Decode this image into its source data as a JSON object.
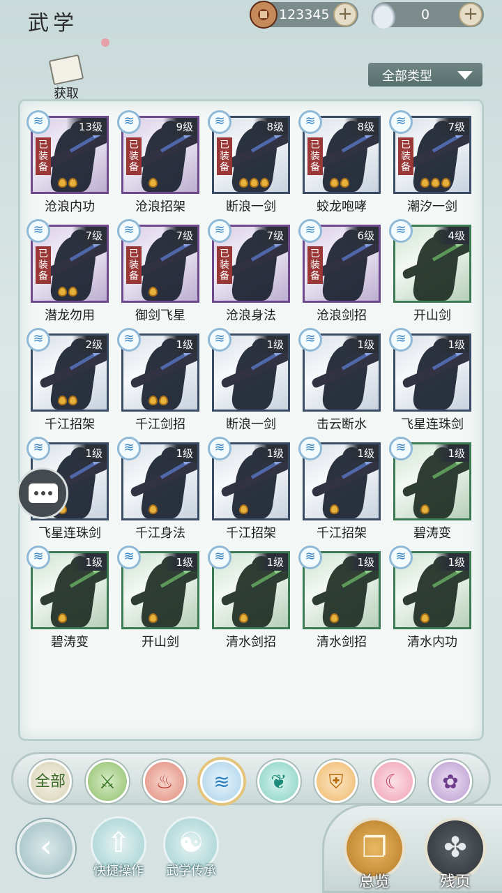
{
  "header": {
    "title": "武学",
    "copper_coins": "123345",
    "silver_ingots": "0",
    "plus_symbol": "+"
  },
  "toolbar": {
    "acquire_label": "获取",
    "filter_label": "全部类型"
  },
  "skills": [
    {
      "name": "沧浪内功",
      "level": "13级",
      "equipped": true,
      "tier": "purple",
      "pips": 2
    },
    {
      "name": "沧浪招架",
      "level": "9级",
      "equipped": true,
      "tier": "purple",
      "pips": 1
    },
    {
      "name": "断浪一剑",
      "level": "8级",
      "equipped": true,
      "tier": "blue",
      "pips": 3
    },
    {
      "name": "蛟龙咆哮",
      "level": "8级",
      "equipped": true,
      "tier": "blue",
      "pips": 2
    },
    {
      "name": "潮汐一剑",
      "level": "7级",
      "equipped": true,
      "tier": "blue",
      "pips": 3
    },
    {
      "name": "潜龙勿用",
      "level": "7级",
      "equipped": true,
      "tier": "purple",
      "pips": 2
    },
    {
      "name": "御剑飞星",
      "level": "7级",
      "equipped": true,
      "tier": "purple",
      "pips": 1
    },
    {
      "name": "沧浪身法",
      "level": "7级",
      "equipped": true,
      "tier": "purple",
      "pips": 0
    },
    {
      "name": "沧浪剑招",
      "level": "6级",
      "equipped": true,
      "tier": "purple",
      "pips": 0
    },
    {
      "name": "开山剑",
      "level": "4级",
      "equipped": false,
      "tier": "green",
      "pips": 0
    },
    {
      "name": "千江招架",
      "level": "2级",
      "equipped": false,
      "tier": "blue",
      "pips": 2
    },
    {
      "name": "千江剑招",
      "level": "1级",
      "equipped": false,
      "tier": "blue",
      "pips": 2
    },
    {
      "name": "断浪一剑",
      "level": "1级",
      "equipped": false,
      "tier": "blue",
      "pips": 0
    },
    {
      "name": "击云断水",
      "level": "1级",
      "equipped": false,
      "tier": "blue",
      "pips": 0
    },
    {
      "name": "飞星连珠剑",
      "level": "1级",
      "equipped": false,
      "tier": "blue",
      "pips": 0
    },
    {
      "name": "飞星连珠剑",
      "level": "1级",
      "equipped": false,
      "tier": "blue",
      "pips": 1
    },
    {
      "name": "千江身法",
      "level": "1级",
      "equipped": false,
      "tier": "blue",
      "pips": 1
    },
    {
      "name": "千江招架",
      "level": "1级",
      "equipped": false,
      "tier": "blue",
      "pips": 1
    },
    {
      "name": "千江招架",
      "level": "1级",
      "equipped": false,
      "tier": "blue",
      "pips": 1
    },
    {
      "name": "碧涛变",
      "level": "1级",
      "equipped": false,
      "tier": "green",
      "pips": 1
    },
    {
      "name": "碧涛变",
      "level": "1级",
      "equipped": false,
      "tier": "green",
      "pips": 1
    },
    {
      "name": "开山剑",
      "level": "1级",
      "equipped": false,
      "tier": "green",
      "pips": 1
    },
    {
      "name": "清水剑招",
      "level": "1级",
      "equipped": false,
      "tier": "green",
      "pips": 1
    },
    {
      "name": "清水剑招",
      "level": "1级",
      "equipped": false,
      "tier": "green",
      "pips": 1
    },
    {
      "name": "清水内功",
      "level": "1级",
      "equipped": false,
      "tier": "green",
      "pips": 1
    }
  ],
  "equipped_label": "已装备",
  "school_badge_glyph": "≋",
  "categories": [
    {
      "id": "all",
      "label": "全部",
      "icon": "all-text-icon"
    },
    {
      "id": "c2",
      "label": "",
      "icon": "sword-icon"
    },
    {
      "id": "c3",
      "label": "",
      "icon": "flame-icon"
    },
    {
      "id": "c4",
      "label": "",
      "icon": "wave-icon"
    },
    {
      "id": "c5",
      "label": "",
      "icon": "butterfly-icon"
    },
    {
      "id": "c6",
      "label": "",
      "icon": "shield-icon"
    },
    {
      "id": "c7",
      "label": "",
      "icon": "crescent-icon"
    },
    {
      "id": "c8",
      "label": "",
      "icon": "flower-icon"
    }
  ],
  "bottom": {
    "quick_ops_label": "快捷操作",
    "inherit_label": "武学传承",
    "overview_label": "总览",
    "fragments_label": "残页"
  },
  "colors": {
    "border_purple": "#6e4a8c",
    "border_blue": "#3a4c64",
    "border_green": "#3b7a52",
    "equipped_red": "#9a3737",
    "selected_ring": "#e4c47a"
  }
}
